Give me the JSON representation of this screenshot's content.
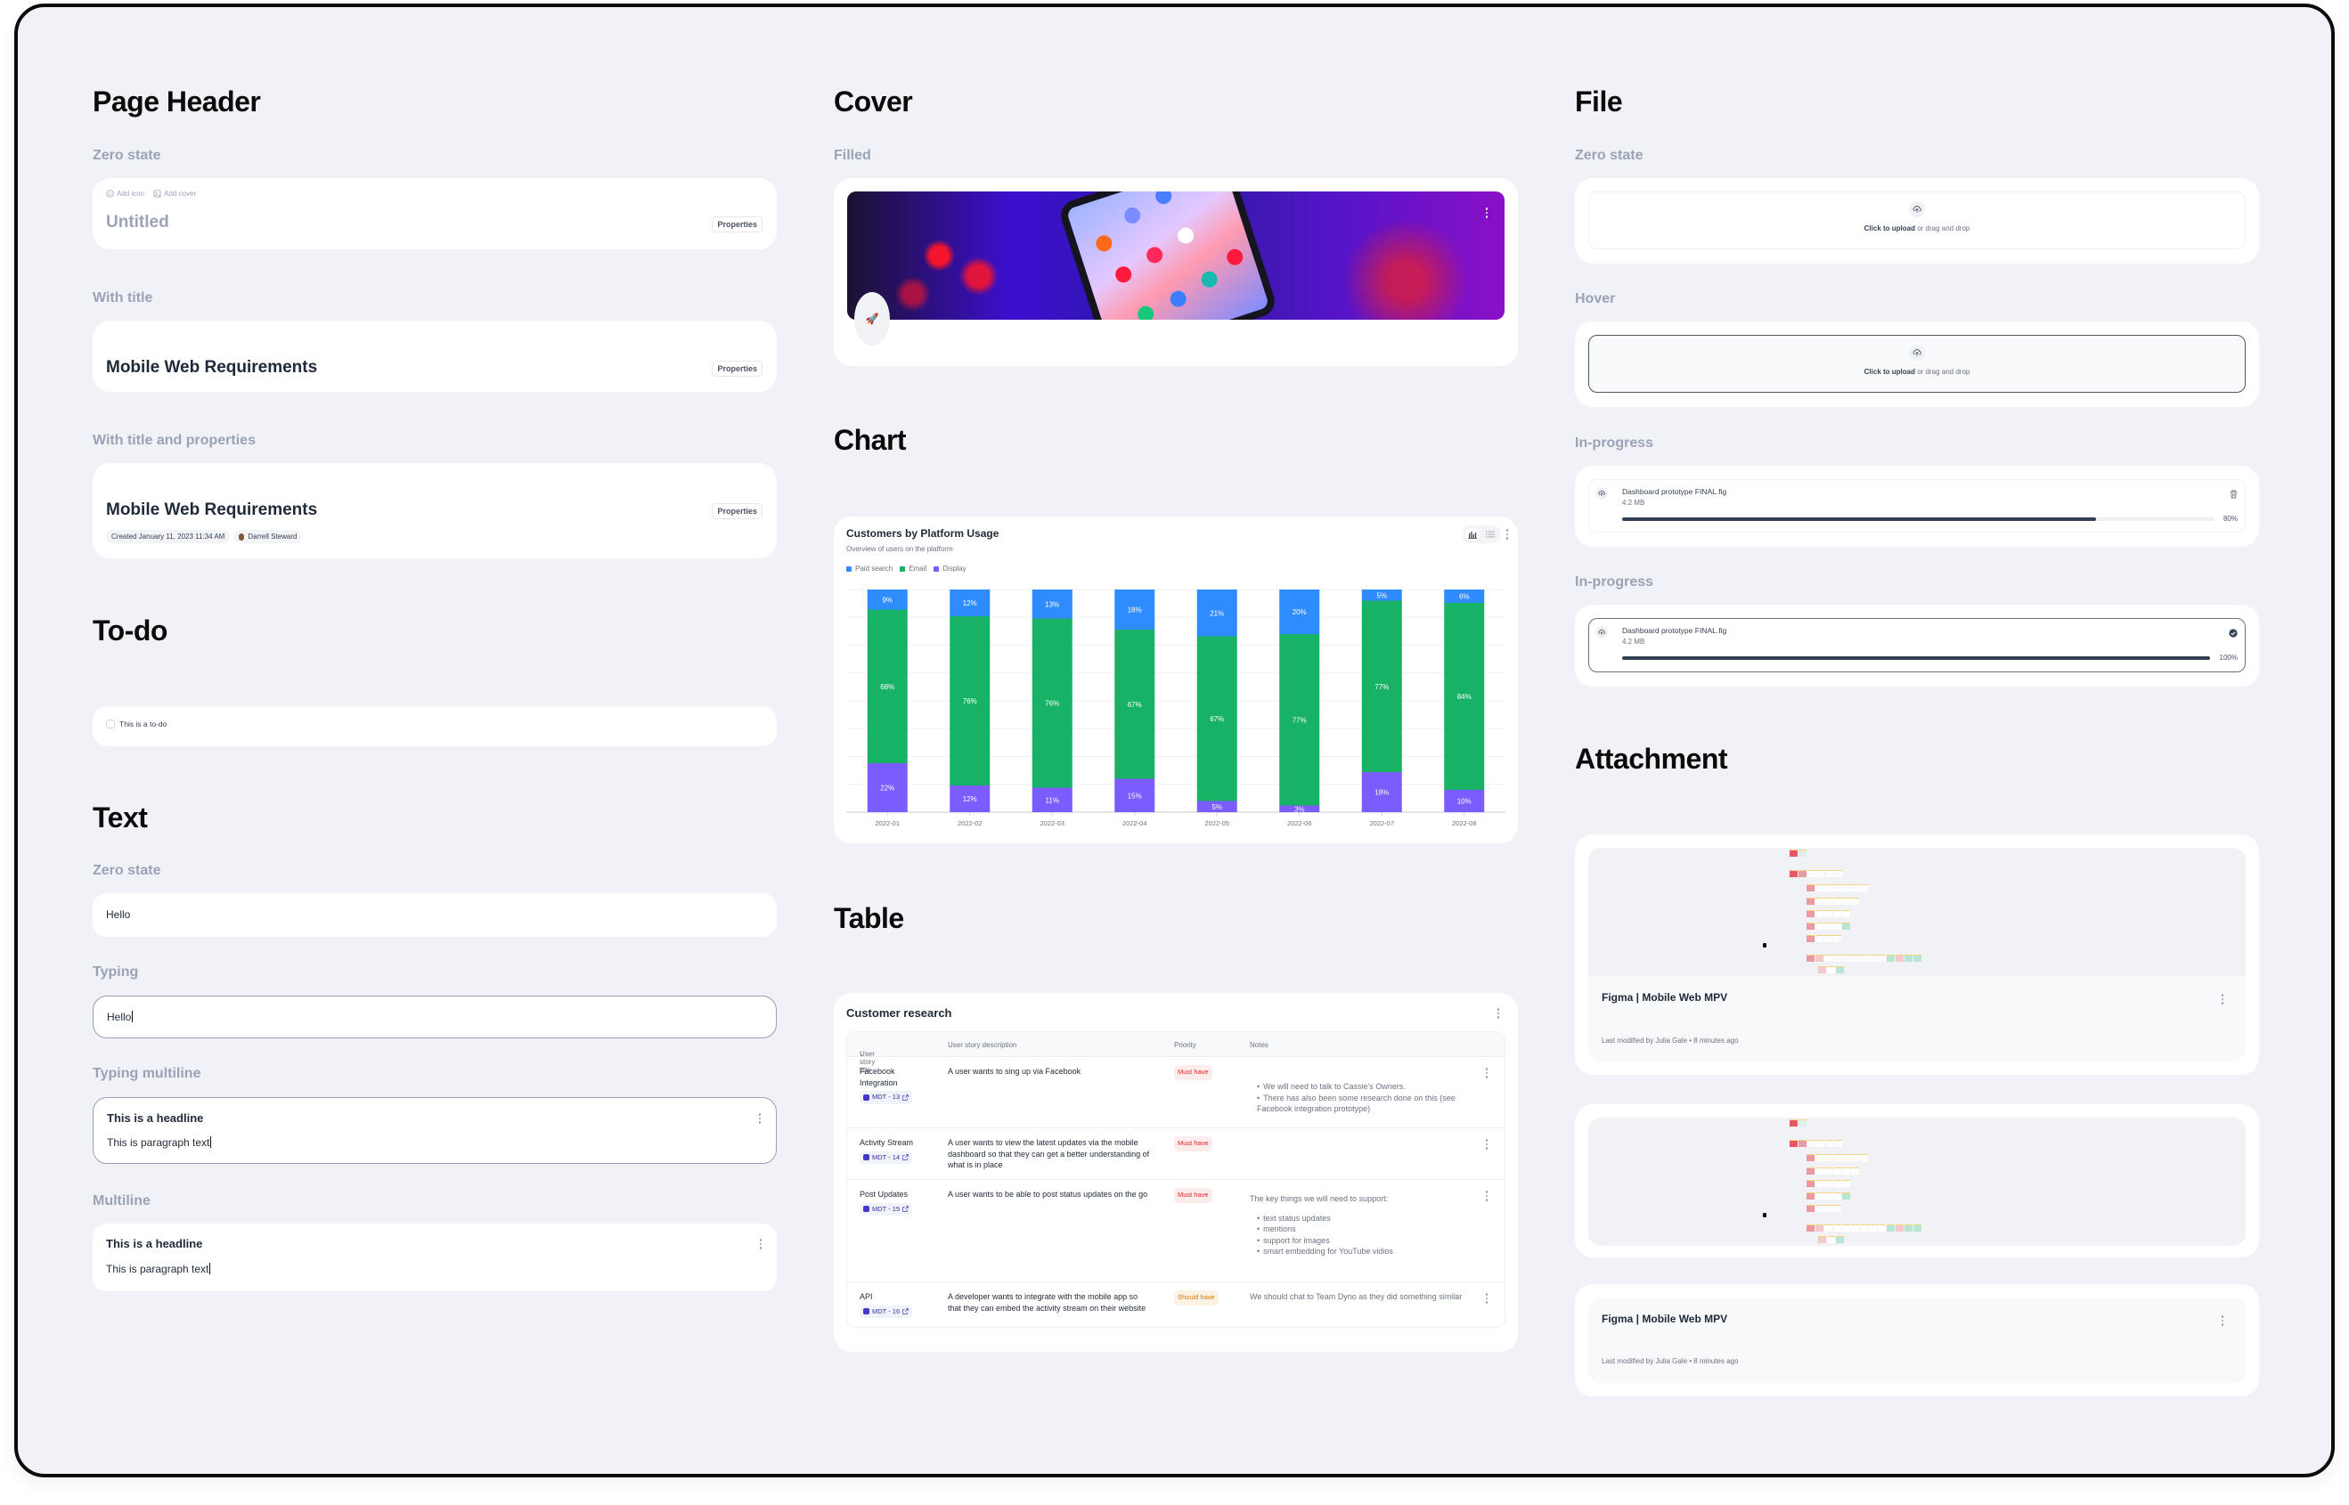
{
  "sections": {
    "page_header": {
      "heading": "Page Header",
      "zero_state": {
        "label": "Zero state",
        "add_icon": "Add icon",
        "add_cover": "Add cover",
        "title_placeholder": "Untitled",
        "properties_button": "Properties"
      },
      "with_title": {
        "label": "With title",
        "title": "Mobile Web Requirements",
        "properties_button": "Properties"
      },
      "with_title_and_properties": {
        "label": "With title and properties",
        "title": "Mobile Web Requirements",
        "properties_button": "Properties",
        "created": "Created January 11, 2023 11:34 AM",
        "author": "Darrell Steward"
      }
    },
    "todo": {
      "heading": "To-do",
      "item_label": "This is a to-do",
      "checked": false
    },
    "text": {
      "heading": "Text",
      "zero_state": {
        "label": "Zero state",
        "value": "Hello"
      },
      "typing": {
        "label": "Typing",
        "value": "Hello"
      },
      "typing_multiline": {
        "label": "Typing multiline",
        "headline": "This is a headline",
        "paragraph": "This is paragraph text"
      },
      "multiline": {
        "label": "Multiline",
        "headline": "This is a headline",
        "paragraph": "This is paragraph text"
      }
    },
    "cover": {
      "heading": "Cover",
      "filled_label": "Filled",
      "icon": "rocket-icon",
      "icon_glyph": "🚀"
    },
    "chart": {
      "heading": "Chart"
    },
    "table": {
      "heading": "Table",
      "title": "Customer research",
      "columns": [
        "User story title",
        "User story description",
        "Priority",
        "Notes"
      ],
      "sort_indicator": "↓",
      "rows": [
        {
          "title": "Facebook Integration",
          "ticket": "MDT - 13",
          "description": "A user wants to sing up via Facebook",
          "priority": "Must have",
          "priority_level": "must",
          "notes_intro": "",
          "notes_list": [
            "We will need to talk to Cassie's Owners.",
            "There has also been some research done on this (see Facebook integration prototype)"
          ]
        },
        {
          "title": "Activity Stream",
          "ticket": "MDT - 14",
          "description": "A user wants to view the latest updates via the mobile dashboard so that they can get a better understanding of what is in place",
          "priority": "Must have",
          "priority_level": "must",
          "notes_intro": "",
          "notes_list": []
        },
        {
          "title": "Post Updates",
          "ticket": "MDT - 15",
          "description": "A user wants to be able to post status updates on the go",
          "priority": "Must have",
          "priority_level": "must",
          "notes_intro": "The key things we will need to support:",
          "notes_list": [
            "text status updates",
            "mentions",
            "support for images",
            "smart embedding for YouTube vidios"
          ]
        },
        {
          "title": "API",
          "ticket": "MDT - 16",
          "description": "A developer wants to integrate with the mobile app so that they can embed the activity stream on their website",
          "priority": "Should have",
          "priority_level": "should",
          "notes_intro": "We should chat to Team Dyno as they did something similar",
          "notes_list": []
        }
      ]
    },
    "file": {
      "heading": "File",
      "zero_state": {
        "label": "Zero state",
        "cta_bold": "Click to upload",
        "cta_rest": " or drag and drop"
      },
      "hover": {
        "label": "Hover",
        "cta_bold": "Click to upload",
        "cta_rest": " or drag and drop"
      },
      "in_progress_1": {
        "label": "In-progress",
        "file_name": "Dashboard prototype FINAL.fig",
        "file_size": "4.2 MB",
        "progress": 80,
        "progress_label": "80%",
        "action_icon": "trash-icon"
      },
      "in_progress_2": {
        "label": "In-progress",
        "file_name": "Dashboard prototype FINAL.fig",
        "file_size": "4.2 MB",
        "progress": 100,
        "progress_label": "100%",
        "action_icon": "check-circle-icon"
      }
    },
    "attachment": {
      "heading": "Attachment",
      "cards": [
        {
          "has_preview": true,
          "title": "Figma | Mobile Web MPV",
          "meta": "Last modified by Julia Gale • 8 minutes ago"
        },
        {
          "has_preview": true,
          "title": "",
          "meta": ""
        },
        {
          "has_preview": false,
          "title": "Figma | Mobile Web MPV",
          "meta": "Last modified by Julia Gale • 8 minutes ago"
        }
      ]
    }
  },
  "colors": {
    "background": "#f1f2f7",
    "paid_search": "#2f8cff",
    "email": "#18b266",
    "display": "#7b5cff",
    "progress": "#334155"
  },
  "chart_data": {
    "type": "bar",
    "stacked": true,
    "title": "Customers by Platform Usage",
    "subtitle": "Overview of users on the platform",
    "xlabel": "",
    "ylabel": "",
    "ylim": [
      0,
      100
    ],
    "grid": true,
    "legend_position": "top-left",
    "categories": [
      "2022-01",
      "2022-02",
      "2022-03",
      "2022-04",
      "2022-05",
      "2022-06",
      "2022-07",
      "2022-08"
    ],
    "series": [
      {
        "name": "Display",
        "color": "#7b5cff",
        "values": [
          22,
          12,
          11,
          15,
          5,
          3,
          18,
          10
        ],
        "labels": [
          "22%",
          "12%",
          "11%",
          "15%",
          "5%",
          "3%",
          "18%",
          "10%"
        ]
      },
      {
        "name": "Email",
        "color": "#18b266",
        "values": [
          69,
          76,
          76,
          67,
          74,
          77,
          77,
          84
        ],
        "labels": [
          "68%",
          "76%",
          "76%",
          "67%",
          "67%",
          "77%",
          "77%",
          "84%"
        ]
      },
      {
        "name": "Paid search",
        "color": "#2f8cff",
        "values": [
          9,
          12,
          13,
          18,
          21,
          20,
          5,
          6
        ],
        "labels": [
          "9%",
          "12%",
          "13%",
          "18%",
          "21%",
          "20%",
          "5%",
          "6%"
        ]
      }
    ],
    "legend": [
      "Paid search",
      "Email",
      "Display"
    ]
  }
}
